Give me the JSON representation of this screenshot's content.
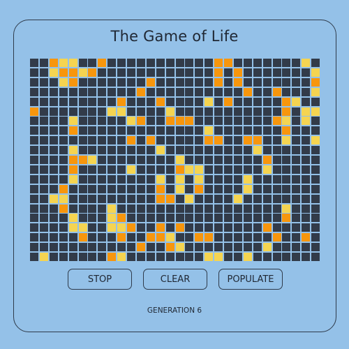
{
  "title": "The Game of Life",
  "buttons": {
    "stop": "STOP",
    "clear": "CLEAR",
    "populate": "POPULATE"
  },
  "generation_label": "GENERATION 6",
  "colors": {
    "dead": "#323b49",
    "orange": "#f7960d",
    "yellow": "#f5d451",
    "background": "#94c1e8"
  },
  "grid": {
    "cols": 30,
    "rows": 20,
    "cells": [
      "..OYY..O...........OO.......Y.",
      "..YOOYO............O.O.......Y",
      "...YO.......O......O.O.......O",
      "...........O..........O..O...Y",
      ".........O...O....Y.O.....OY..",
      "O.......YY....Y...........O.YY",
      "....Y.....YO..OOO........OY.Y.",
      "....O.............Y.......O...",
      "..........O.O.....OO..OO..Y..Y",
      "....Y........Y.........Y......",
      "....OOY........Y........O.....",
      "....O.....Y....OYY......Y.....",
      "....Y........Y.Y.Y....Y.......",
      "...O.........O.Y.O....Y.......",
      "..YY.........OO.Y....Y........",
      "...O....Y.................Y...",
      "....Y...YO................O...",
      "....YY..YYO..O.O........O.....",
      ".....O...O..OOY..OO......O..O.",
      "...........O..OY........Y.....",
      ".Y......OY........YY..Y......."
    ]
  }
}
